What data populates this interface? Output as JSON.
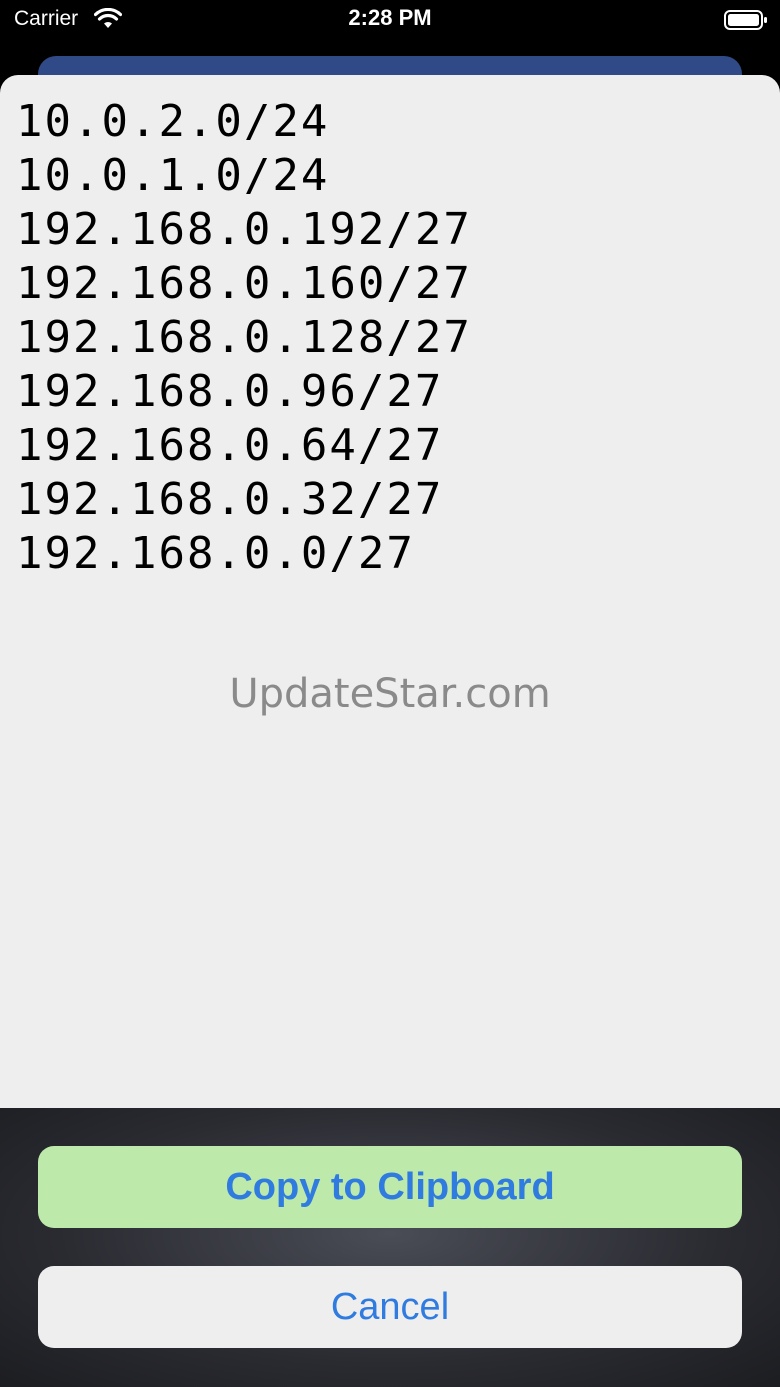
{
  "status_bar": {
    "carrier": "Carrier",
    "time": "2:28 PM",
    "icons": [
      "wifi-icon",
      "battery-icon"
    ]
  },
  "sheet": {
    "subnets": [
      "10.0.2.0/24",
      "10.0.1.0/24",
      "192.168.0.192/27",
      "192.168.0.160/27",
      "192.168.0.128/27",
      "192.168.0.96/27",
      "192.168.0.64/27",
      "192.168.0.32/27",
      "192.168.0.0/27"
    ],
    "watermark": "UpdateStar.com"
  },
  "actions": {
    "copy_label": "Copy to Clipboard",
    "cancel_label": "Cancel"
  },
  "colors": {
    "accent": "#2f7be0",
    "copy_button_bg": "#bde9ab",
    "sheet_bg": "#eeeeee",
    "behind_card": "#2f4a86"
  }
}
